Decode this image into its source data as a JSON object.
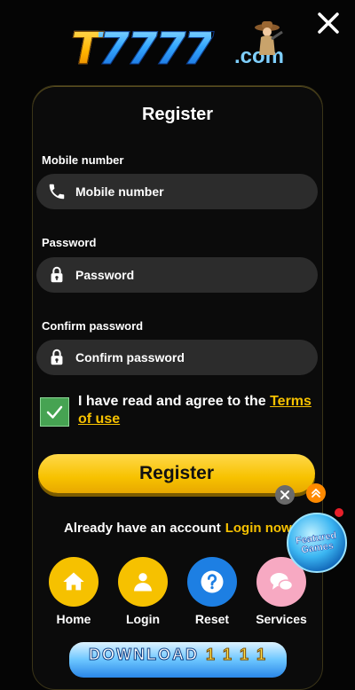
{
  "logo": {
    "main": "T7777",
    "suffix": ".com"
  },
  "form": {
    "title": "Register",
    "mobile": {
      "label": "Mobile number",
      "placeholder": "Mobile number"
    },
    "password": {
      "label": "Password",
      "placeholder": "Password"
    },
    "confirm": {
      "label": "Confirm password",
      "placeholder": "Confirm password"
    },
    "agree_text": "I have read and agree to the ",
    "terms_link": "Terms of use",
    "checkbox_checked": true,
    "submit_label": "Register"
  },
  "login": {
    "prompt": "Already have an account",
    "link": "Login now"
  },
  "nav": [
    {
      "label": "Home",
      "icon": "home-icon",
      "color": "#f6c100"
    },
    {
      "label": "Login",
      "icon": "user-icon",
      "color": "#f6c100"
    },
    {
      "label": "Reset",
      "icon": "question-icon",
      "color": "#1d7fe3"
    },
    {
      "label": "Services",
      "icon": "chat-bubbles-icon",
      "color": "#f7a9c2"
    }
  ],
  "download": {
    "label": "DOWNLOAD",
    "number": "1 1 1 1"
  },
  "featured": {
    "line1": "Featured",
    "line2": "Games"
  },
  "colors": {
    "accent": "#f6c100",
    "background": "#050505",
    "field": "#2c2c2c",
    "checkbox": "#46a352"
  }
}
